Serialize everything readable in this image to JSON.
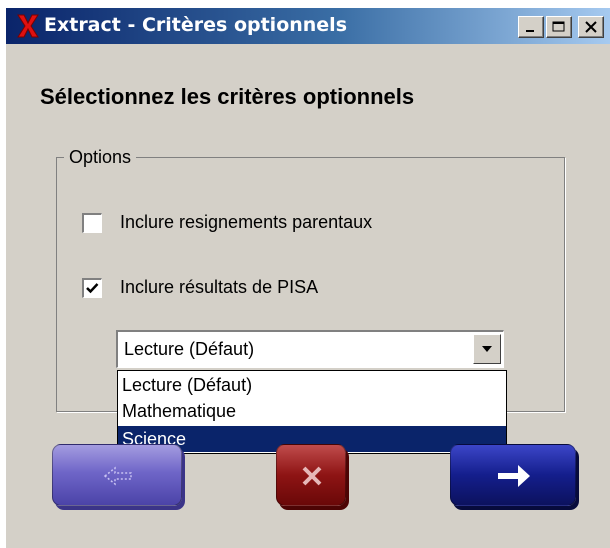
{
  "window": {
    "title": "Extract - Critères optionnels",
    "heading": "Sélectionnez les critères optionnels"
  },
  "options_group": {
    "legend": "Options",
    "checkboxes": [
      {
        "label": "Inclure resignements parentaux",
        "checked": false
      },
      {
        "label": "Inclure résultats de PISA",
        "checked": true
      }
    ]
  },
  "pisa_select": {
    "selected_value": "Lecture (Défaut)",
    "options": [
      "Lecture (Défaut)",
      "Mathematique",
      "Science"
    ],
    "highlighted_option": "Science"
  },
  "nav_buttons": [
    {
      "name": "back",
      "icon": "arrow-left-icon",
      "enabled": false
    },
    {
      "name": "cancel",
      "icon": "close-icon"
    },
    {
      "name": "next",
      "icon": "arrow-right-icon"
    }
  ],
  "colors": {
    "titlebar_start": "#0a246a",
    "titlebar_end": "#a6caf0",
    "selection": "#0a246a",
    "back_button": "#6f66c8",
    "cancel_button": "#8e1414",
    "next_button": "#141e8c"
  }
}
